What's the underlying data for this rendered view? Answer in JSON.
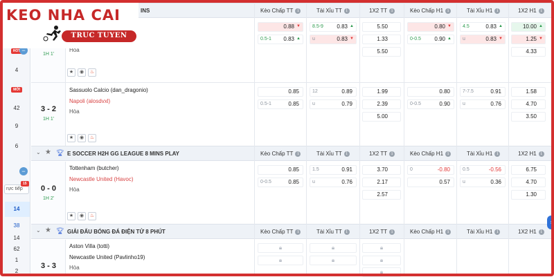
{
  "logo": {
    "title": "KEO NHA CAI",
    "subtitle": "TRUC TUYEN"
  },
  "top_league_tail": "INS",
  "columns": [
    "Kèo Chấp TT",
    "Tài Xỉu TT",
    "1X2 TT",
    "Kèo Chấp H1",
    "Tài Xỉu H1",
    "1X2 H1"
  ],
  "sidebar": {
    "badge_hot": "HOT",
    "items": [
      "4",
      "42",
      "9",
      "6",
      "14",
      "38",
      "14",
      "62",
      "1",
      "2"
    ],
    "badge_new": "MỚI",
    "search_placeholder": "rực tiếp",
    "search_badge": "15"
  },
  "leagues": [
    {
      "name": "E SOCCER H2H GG LEAGUE 8 MINS PLAY"
    },
    {
      "name": "GIẢI ĐẤU BÓNG ĐÁ ĐIỆN TỬ 8 PHÚT"
    }
  ],
  "matches": [
    {
      "home": "",
      "away": "",
      "draw": "Hòa",
      "score": "",
      "time": "1H 1'",
      "odds": {
        "hc_tt": [
          {
            "h": "",
            "v": "0.88",
            "arr": "down"
          },
          {
            "h": "0.5-1",
            "v": "0.83",
            "arr": "up"
          }
        ],
        "tx_tt": [
          {
            "h": "8.5-9",
            "v": "0.83",
            "arr": "up"
          },
          {
            "h": "u",
            "v": "0.83",
            "arr": "down"
          }
        ],
        "x12_tt": [
          "5.50",
          "1.33",
          "5.50"
        ],
        "hc_h1": [
          {
            "h": "",
            "v": "0.80",
            "arr": "down"
          },
          {
            "h": "0-0.5",
            "v": "0.90",
            "arr": "up"
          }
        ],
        "tx_h1": [
          {
            "h": "4.5",
            "v": "0.83",
            "arr": "up"
          },
          {
            "h": "u",
            "v": "0.83",
            "arr": "down"
          }
        ],
        "x12_h1": [
          {
            "v": "10.00",
            "arr": "up"
          },
          {
            "v": "1.25",
            "arr": "down"
          },
          {
            "v": "4.33",
            "arr": ""
          }
        ]
      }
    },
    {
      "home": "Sassuolo Calcio (dan_dragonio)",
      "away": "Napoli (alosdvxl)",
      "draw": "Hòa",
      "score": "3 - 2",
      "time": "1H 1'",
      "odds": {
        "hc_tt": [
          {
            "h": "",
            "v": "0.85"
          },
          {
            "h": "0.5-1",
            "v": "0.85"
          }
        ],
        "tx_tt": [
          {
            "h": "12",
            "v": "0.89"
          },
          {
            "h": "u",
            "v": "0.79"
          }
        ],
        "x12_tt": [
          "1.99",
          "2.39",
          "5.00"
        ],
        "hc_h1": [
          {
            "h": "",
            "v": "0.80"
          },
          {
            "h": "0-0.5",
            "v": "0.90"
          }
        ],
        "tx_h1": [
          {
            "h": "7-7.5",
            "v": "0.91"
          },
          {
            "h": "u",
            "v": "0.76"
          }
        ],
        "x12_h1": [
          "1.58",
          "4.70",
          "3.50"
        ]
      }
    },
    {
      "home": "Tottenham (butcher)",
      "away": "Newcastle United (Havoc)",
      "draw": "Hòa",
      "score": "0 - 0",
      "time": "1H 2'",
      "odds": {
        "hc_tt": [
          {
            "h": "",
            "v": "0.85"
          },
          {
            "h": "0-0.5",
            "v": "0.85"
          }
        ],
        "tx_tt": [
          {
            "h": "1.5",
            "v": "0.91"
          },
          {
            "h": "u",
            "v": "0.76"
          }
        ],
        "x12_tt": [
          "3.70",
          "2.17",
          "2.57"
        ],
        "hc_h1": [
          {
            "h": "0",
            "v": "-0.80"
          },
          {
            "h": "",
            "v": "0.57"
          }
        ],
        "tx_h1": [
          {
            "h": "0.5",
            "v": "-0.56"
          },
          {
            "h": "u",
            "v": "0.36"
          }
        ],
        "x12_h1": [
          "6.75",
          "4.70",
          "1.30"
        ]
      }
    },
    {
      "home": "Aston Villa (totti)",
      "away": "Newcastle United (Pavlinho19)",
      "draw": "Hòa",
      "score": "3 - 3",
      "time": ""
    }
  ],
  "icons": [
    "star-icon",
    "eye-icon",
    "fire-icon",
    "info-icon",
    "lock-icon",
    "trophy-icon",
    "chevron-down-icon"
  ],
  "colors": {
    "frame": "#d32f2f",
    "up_bg": "#fde6e6",
    "green_time": "#2e9b4f",
    "away_team": "#d84343",
    "accent_blue": "#2f72d8"
  }
}
